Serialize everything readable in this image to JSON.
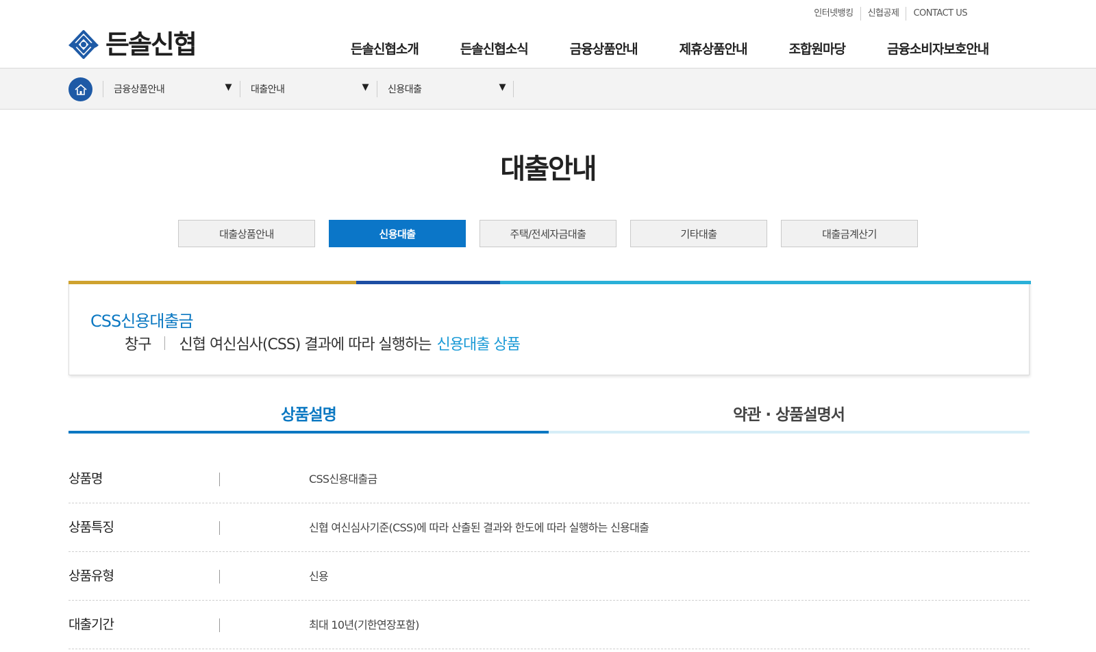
{
  "header": {
    "util_links": [
      "인터넷뱅킹",
      "신협공제",
      "CONTACT US"
    ],
    "logo_text": "든솔신협",
    "gnb": [
      "든솔신협소개",
      "든솔신협소식",
      "금융상품안내",
      "제휴상품안내",
      "조합원마당",
      "금융소비자보호안내"
    ]
  },
  "location": {
    "items": [
      {
        "label": "금융상품안내"
      },
      {
        "label": "대출안내"
      },
      {
        "label": "신용대출"
      }
    ],
    "dropdown_glyph": "▼"
  },
  "page_title": "대출안내",
  "sub_tabs": [
    {
      "label": "대출상품안내",
      "active": false
    },
    {
      "label": "신용대출",
      "active": true
    },
    {
      "label": "주택/전세자금대출",
      "active": false
    },
    {
      "label": "기타대출",
      "active": false
    },
    {
      "label": "대출금계산기",
      "active": false
    }
  ],
  "product": {
    "name": "CSS신용대출금",
    "channel": "창구",
    "desc_plain": "신협 여신심사(CSS) 결과에 따라 실행하는",
    "desc_highlight": "신용대출 상품"
  },
  "content_tabs": [
    {
      "label": "상품설명",
      "active": true
    },
    {
      "label": "약관 · 상품설명서",
      "active": false
    }
  ],
  "info_rows": [
    {
      "label": "상품명",
      "value": "CSS신용대출금"
    },
    {
      "label": "상품특징",
      "value": "신협 여신심사기준(CSS)에 따라 산출된 결과와 한도에 따라 실행하는 신용대출"
    },
    {
      "label": "상품유형",
      "value": "신용"
    },
    {
      "label": "대출기간",
      "value": "최대 10년(기한연장포함)"
    }
  ],
  "colors": {
    "primary_blue": "#0b76c8",
    "highlight_blue": "#1a9ad6",
    "home_blue": "#1e5aa6",
    "bar_gold": "#cfa22f",
    "bar_navy": "#1d4ea3",
    "bar_sky": "#2ab0d8"
  }
}
